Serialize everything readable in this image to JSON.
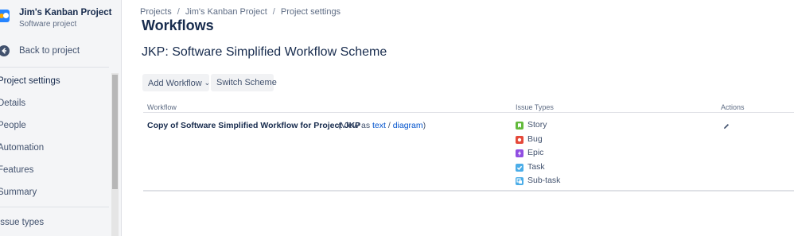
{
  "sidebar": {
    "project_name": "Jim's Kanban Project",
    "project_type": "Software project",
    "back_label": "Back to project",
    "items": [
      {
        "label": "Project settings"
      },
      {
        "label": "Details"
      },
      {
        "label": "People"
      },
      {
        "label": "Automation"
      },
      {
        "label": "Features"
      },
      {
        "label": "Summary"
      },
      {
        "label": "Issue types"
      }
    ]
  },
  "breadcrumb": {
    "items": [
      "Projects",
      "Jim's Kanban Project",
      "Project settings"
    ]
  },
  "page": {
    "title": "Workflows",
    "scheme_title": "JKP: Software Simplified Workflow Scheme"
  },
  "toolbar": {
    "add_workflow_label": "Add Workflow",
    "switch_scheme_label": "Switch Scheme"
  },
  "table": {
    "headers": {
      "workflow": "Workflow",
      "issue_types": "Issue Types",
      "actions": "Actions"
    },
    "rows": [
      {
        "workflow": "Copy of Software Simplified Workflow for Project JKP",
        "view_as_prefix": "(View as",
        "view_text_link": "text",
        "view_sep": "/",
        "view_diagram_link": "diagram",
        "view_as_suffix": ")",
        "issue_types": [
          {
            "label": "Story",
            "icon": "story-icon",
            "color": "#63ba3c"
          },
          {
            "label": "Bug",
            "icon": "bug-icon",
            "color": "#e5493a"
          },
          {
            "label": "Epic",
            "icon": "epic-icon",
            "color": "#904ee2"
          },
          {
            "label": "Task",
            "icon": "task-icon",
            "color": "#4bade8"
          },
          {
            "label": "Sub-task",
            "icon": "subtask-icon",
            "color": "#4bade8"
          }
        ]
      }
    ]
  },
  "colors": {
    "link": "#0052cc",
    "text": "#172b4d",
    "sidebar_bg": "#f4f5f7"
  }
}
